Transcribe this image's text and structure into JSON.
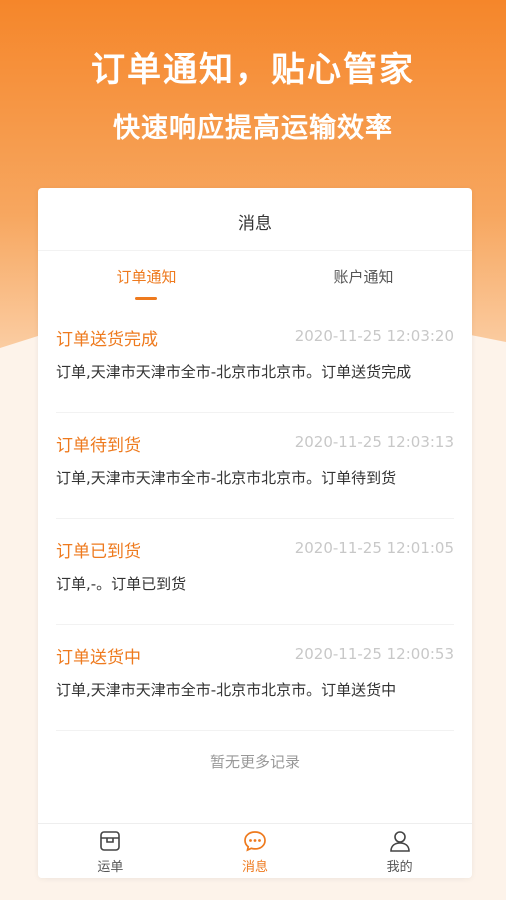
{
  "hero": {
    "title": "订单通知，贴心管家",
    "subtitle": "快速响应提高运输效率"
  },
  "card": {
    "header": "消息",
    "tabs": [
      {
        "label": "订单通知",
        "active": true
      },
      {
        "label": "账户通知",
        "active": false
      }
    ],
    "messages": [
      {
        "title": "订单送货完成",
        "time": "2020-11-25 12:03:20",
        "body": "订单,天津市天津市全市-北京市北京市。订单送货完成"
      },
      {
        "title": "订单待到货",
        "time": "2020-11-25 12:03:13",
        "body": "订单,天津市天津市全市-北京市北京市。订单待到货"
      },
      {
        "title": "订单已到货",
        "time": "2020-11-25 12:01:05",
        "body": "订单,-。订单已到货"
      },
      {
        "title": "订单送货中",
        "time": "2020-11-25 12:00:53",
        "body": "订单,天津市天津市全市-北京市北京市。订单送货中"
      }
    ],
    "no_more": "暂无更多记录"
  },
  "tabbar": [
    {
      "label": "运单",
      "icon": "waybill-icon",
      "active": false
    },
    {
      "label": "消息",
      "icon": "chat-icon",
      "active": true
    },
    {
      "label": "我的",
      "icon": "user-icon",
      "active": false
    }
  ],
  "colors": {
    "accent": "#ee7a1e",
    "hero_top": "#f5862a",
    "hero_bottom": "#fbd0a8"
  }
}
